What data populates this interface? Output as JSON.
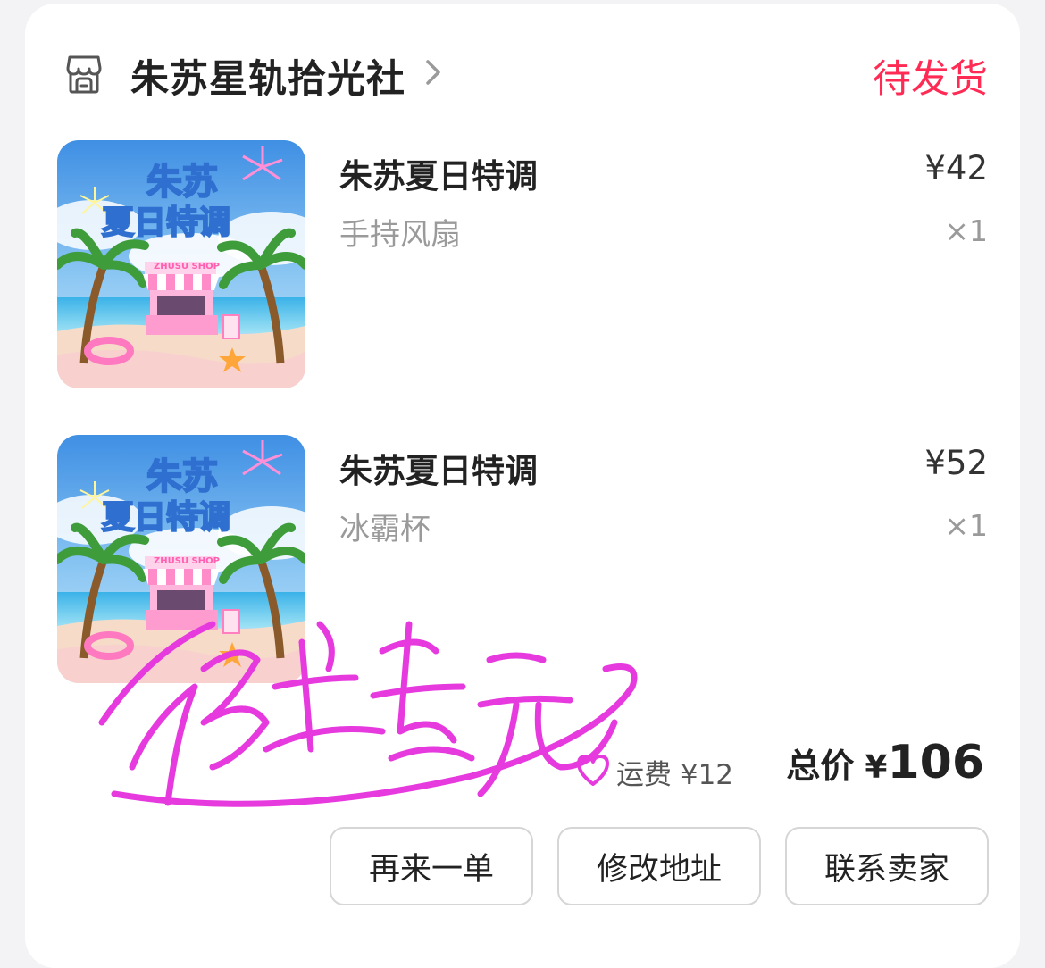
{
  "shop": {
    "name": "朱苏星轨拾光社",
    "status": "待发货",
    "icon": "storefront-icon"
  },
  "items": [
    {
      "title": "朱苏夏日特调",
      "spec": "手持风扇",
      "price": "¥42",
      "qty": "×1",
      "thumb": {
        "banner": "朱苏",
        "subtitle": "夏日特调",
        "shop_sign": "ZHUSU SHOP"
      }
    },
    {
      "title": "朱苏夏日特调",
      "spec": "冰霸杯",
      "price": "¥52",
      "qty": "×1",
      "thumb": {
        "banner": "朱苏",
        "subtitle": "夏日特调",
        "shop_sign": "ZHUSU SHOP"
      }
    }
  ],
  "summary": {
    "shipping": "运费 ¥12",
    "total_label": "总价",
    "total_currency": "¥",
    "total_value": "106"
  },
  "overlay": {
    "signature_text": "你的生日快乐元",
    "signature_color": "#e63adf"
  },
  "actions": {
    "reorder": "再来一单",
    "edit_address": "修改地址",
    "contact_seller": "联系卖家"
  },
  "colors": {
    "status": "#ff2b54",
    "accent_pink": "#e63adf",
    "sky": "#5aa9ec"
  }
}
